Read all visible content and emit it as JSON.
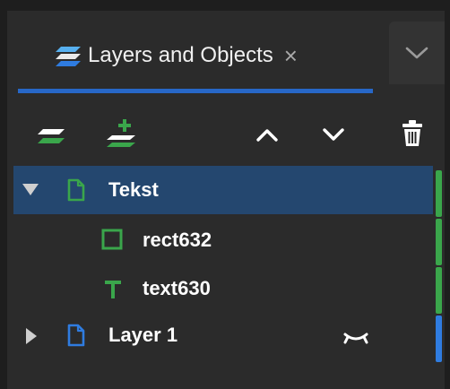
{
  "panel": {
    "tab_title": "Layers and Objects",
    "tab_close_glyph": "×",
    "tab_icon": "layers-icon",
    "dropdown_icon": "chevron-down-icon"
  },
  "toolbar": {
    "buttons": [
      {
        "name": "add-layer-button",
        "icon": "layers-icon"
      },
      {
        "name": "add-sublayer-button",
        "icon": "layer-plus-icon"
      },
      {
        "name": "raise-button",
        "icon": "chevron-up-icon"
      },
      {
        "name": "lower-button",
        "icon": "chevron-down-icon"
      },
      {
        "name": "delete-button",
        "icon": "trash-icon"
      }
    ]
  },
  "tree": {
    "items": [
      {
        "label": "Tekst",
        "type": "layer",
        "expanded": true,
        "selected": true,
        "color": "#3aa64b",
        "icon": "page-icon"
      },
      {
        "label": "rect632",
        "type": "rect",
        "color": "#3aa64b",
        "icon": "square-icon"
      },
      {
        "label": "text630",
        "type": "text",
        "color": "#3aa64b",
        "icon": "text-icon"
      },
      {
        "label": "Layer 1",
        "type": "layer",
        "expanded": false,
        "color": "#2f7ce0",
        "icon": "page-icon",
        "hidden": true
      }
    ]
  },
  "colors": {
    "accent_blue": "#2767c7",
    "layer_green": "#3aa64b",
    "layer_blue": "#2f7ce0",
    "selected_row": "#24476f"
  }
}
